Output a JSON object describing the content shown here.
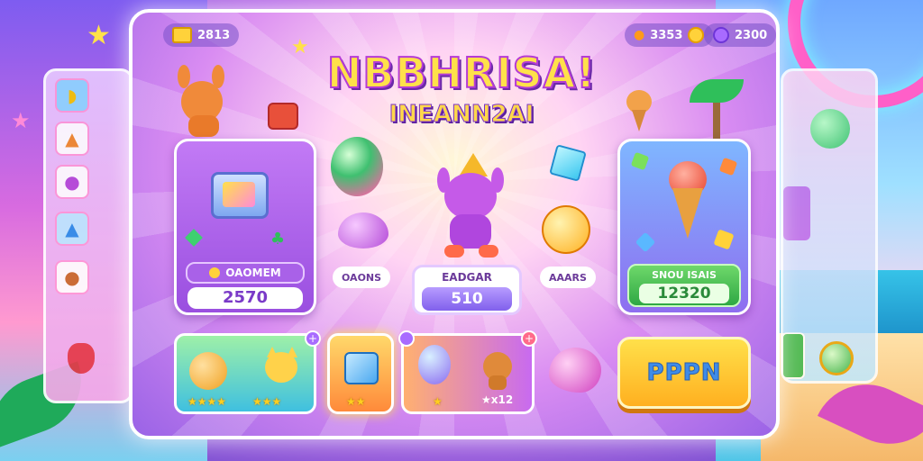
{
  "currency": {
    "tickets": "2813",
    "coins": "3353",
    "gems": "2300"
  },
  "title": {
    "main": "NBBHRISA!",
    "subtitle": "INEANN2AI"
  },
  "cards": {
    "left": {
      "label": "OAOMEM",
      "value": "2570"
    },
    "center_left": {
      "label": "OAONS"
    },
    "center": {
      "label": "EADGAR",
      "value": "510"
    },
    "center_right": {
      "label": "AAARS"
    },
    "right": {
      "label": "SNOU ISAIS",
      "value": "12320"
    }
  },
  "items": [
    {
      "stars": "★★★★",
      "stars2": "★★★"
    },
    {
      "stars": "★★"
    },
    {
      "stars": "★",
      "level": "12"
    }
  ],
  "play_label": "PPPN",
  "colors": {
    "accent_purple": "#9a4fe0",
    "accent_green": "#38b64a",
    "accent_yellow": "#ffd23a"
  },
  "icons": [
    "ticket-icon",
    "coin-icon",
    "gem-icon",
    "pumpkin-icon",
    "cat-icon",
    "dice-icon",
    "balloon-icon",
    "fox-icon",
    "kangaroo-icon",
    "ice-cream-icon",
    "computer-icon",
    "star-icon"
  ]
}
